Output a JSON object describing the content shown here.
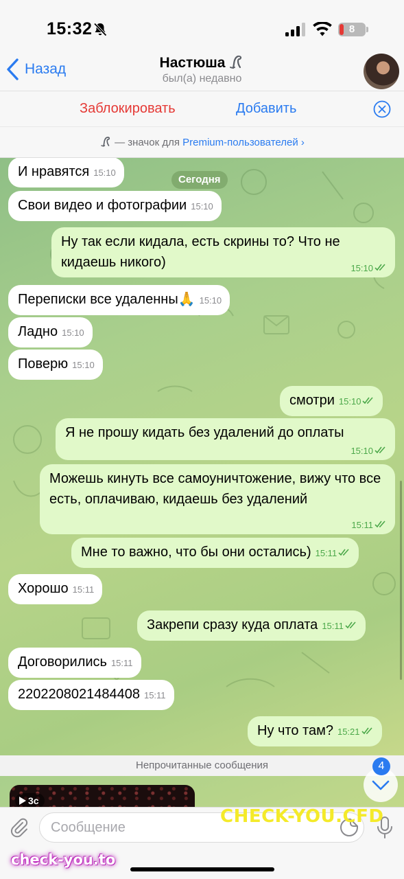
{
  "status_bar": {
    "time": "15:32",
    "battery_level": "8",
    "battery_color": "#e53935"
  },
  "nav": {
    "back_label": "Назад",
    "title": "Настюша",
    "subtitle": "был(а) недавно"
  },
  "actions": {
    "block_label": "Заблокировать",
    "add_label": "Добавить"
  },
  "premium_note": {
    "text": "— значок для ",
    "link": "Premium-пользователей"
  },
  "date_pill": "Сегодня",
  "messages": [
    {
      "dir": "in",
      "text": "И нравятся",
      "time": "15:10"
    },
    {
      "dir": "in",
      "text": "Свои видео и фотографии",
      "time": "15:10"
    },
    {
      "dir": "out",
      "text": "Ну так если кидала, есть скрины то? Что не кидаешь никого)",
      "time": "15:10"
    },
    {
      "dir": "in",
      "text": "Переписки все удаленны🙏",
      "time": "15:10"
    },
    {
      "dir": "in",
      "text": "Ладно",
      "time": "15:10"
    },
    {
      "dir": "in",
      "text": "Поверю",
      "time": "15:10"
    },
    {
      "dir": "out",
      "text": "смотри",
      "time": "15:10"
    },
    {
      "dir": "out",
      "text": "Я не прошу кидать без удалений до оплаты",
      "time": "15:10"
    },
    {
      "dir": "out",
      "text": "Можешь кинуть все самоуничтожение,  вижу что все есть, оплачиваю, кидаешь без удалений",
      "time": "15:11"
    },
    {
      "dir": "out",
      "text": "Мне то важно, что бы они остались)",
      "time": "15:11"
    },
    {
      "dir": "in",
      "text": "Хорошо",
      "time": "15:11"
    },
    {
      "dir": "out",
      "text": "Закрепи сразу куда оплата",
      "time": "15:11"
    },
    {
      "dir": "in",
      "text": "Договорились",
      "time": "15:11"
    },
    {
      "dir": "in",
      "text": "2202208021484408",
      "time": "15:11"
    },
    {
      "dir": "out",
      "text": "Ну что там?",
      "time": "15:21"
    }
  ],
  "unread_separator": "Непрочитанные сообщения",
  "unread_count": "4",
  "video": {
    "duration": "3с"
  },
  "composer": {
    "placeholder": "Сообщение"
  },
  "watermarks": {
    "overlay": "CHECK-YOU.CFD",
    "corner": "check-you.to"
  },
  "icons": {
    "mute": "bell-slash-icon",
    "signal": "cellular-signal-icon",
    "wifi": "wifi-icon",
    "back": "chevron-left-icon",
    "close": "close-circle-icon",
    "attach": "paperclip-icon",
    "sticker": "sticker-icon",
    "mic": "microphone-icon",
    "scroll_down": "chevron-down-icon",
    "premium": "dinosaur-emoji-icon",
    "read": "double-check-icon",
    "play": "play-icon"
  },
  "colors": {
    "accent": "#2a7bf0",
    "danger": "#e53935",
    "outgoing_bubble": "#e1f9c9",
    "incoming_bubble": "#ffffff",
    "read_ticks": "#4ca84a"
  }
}
